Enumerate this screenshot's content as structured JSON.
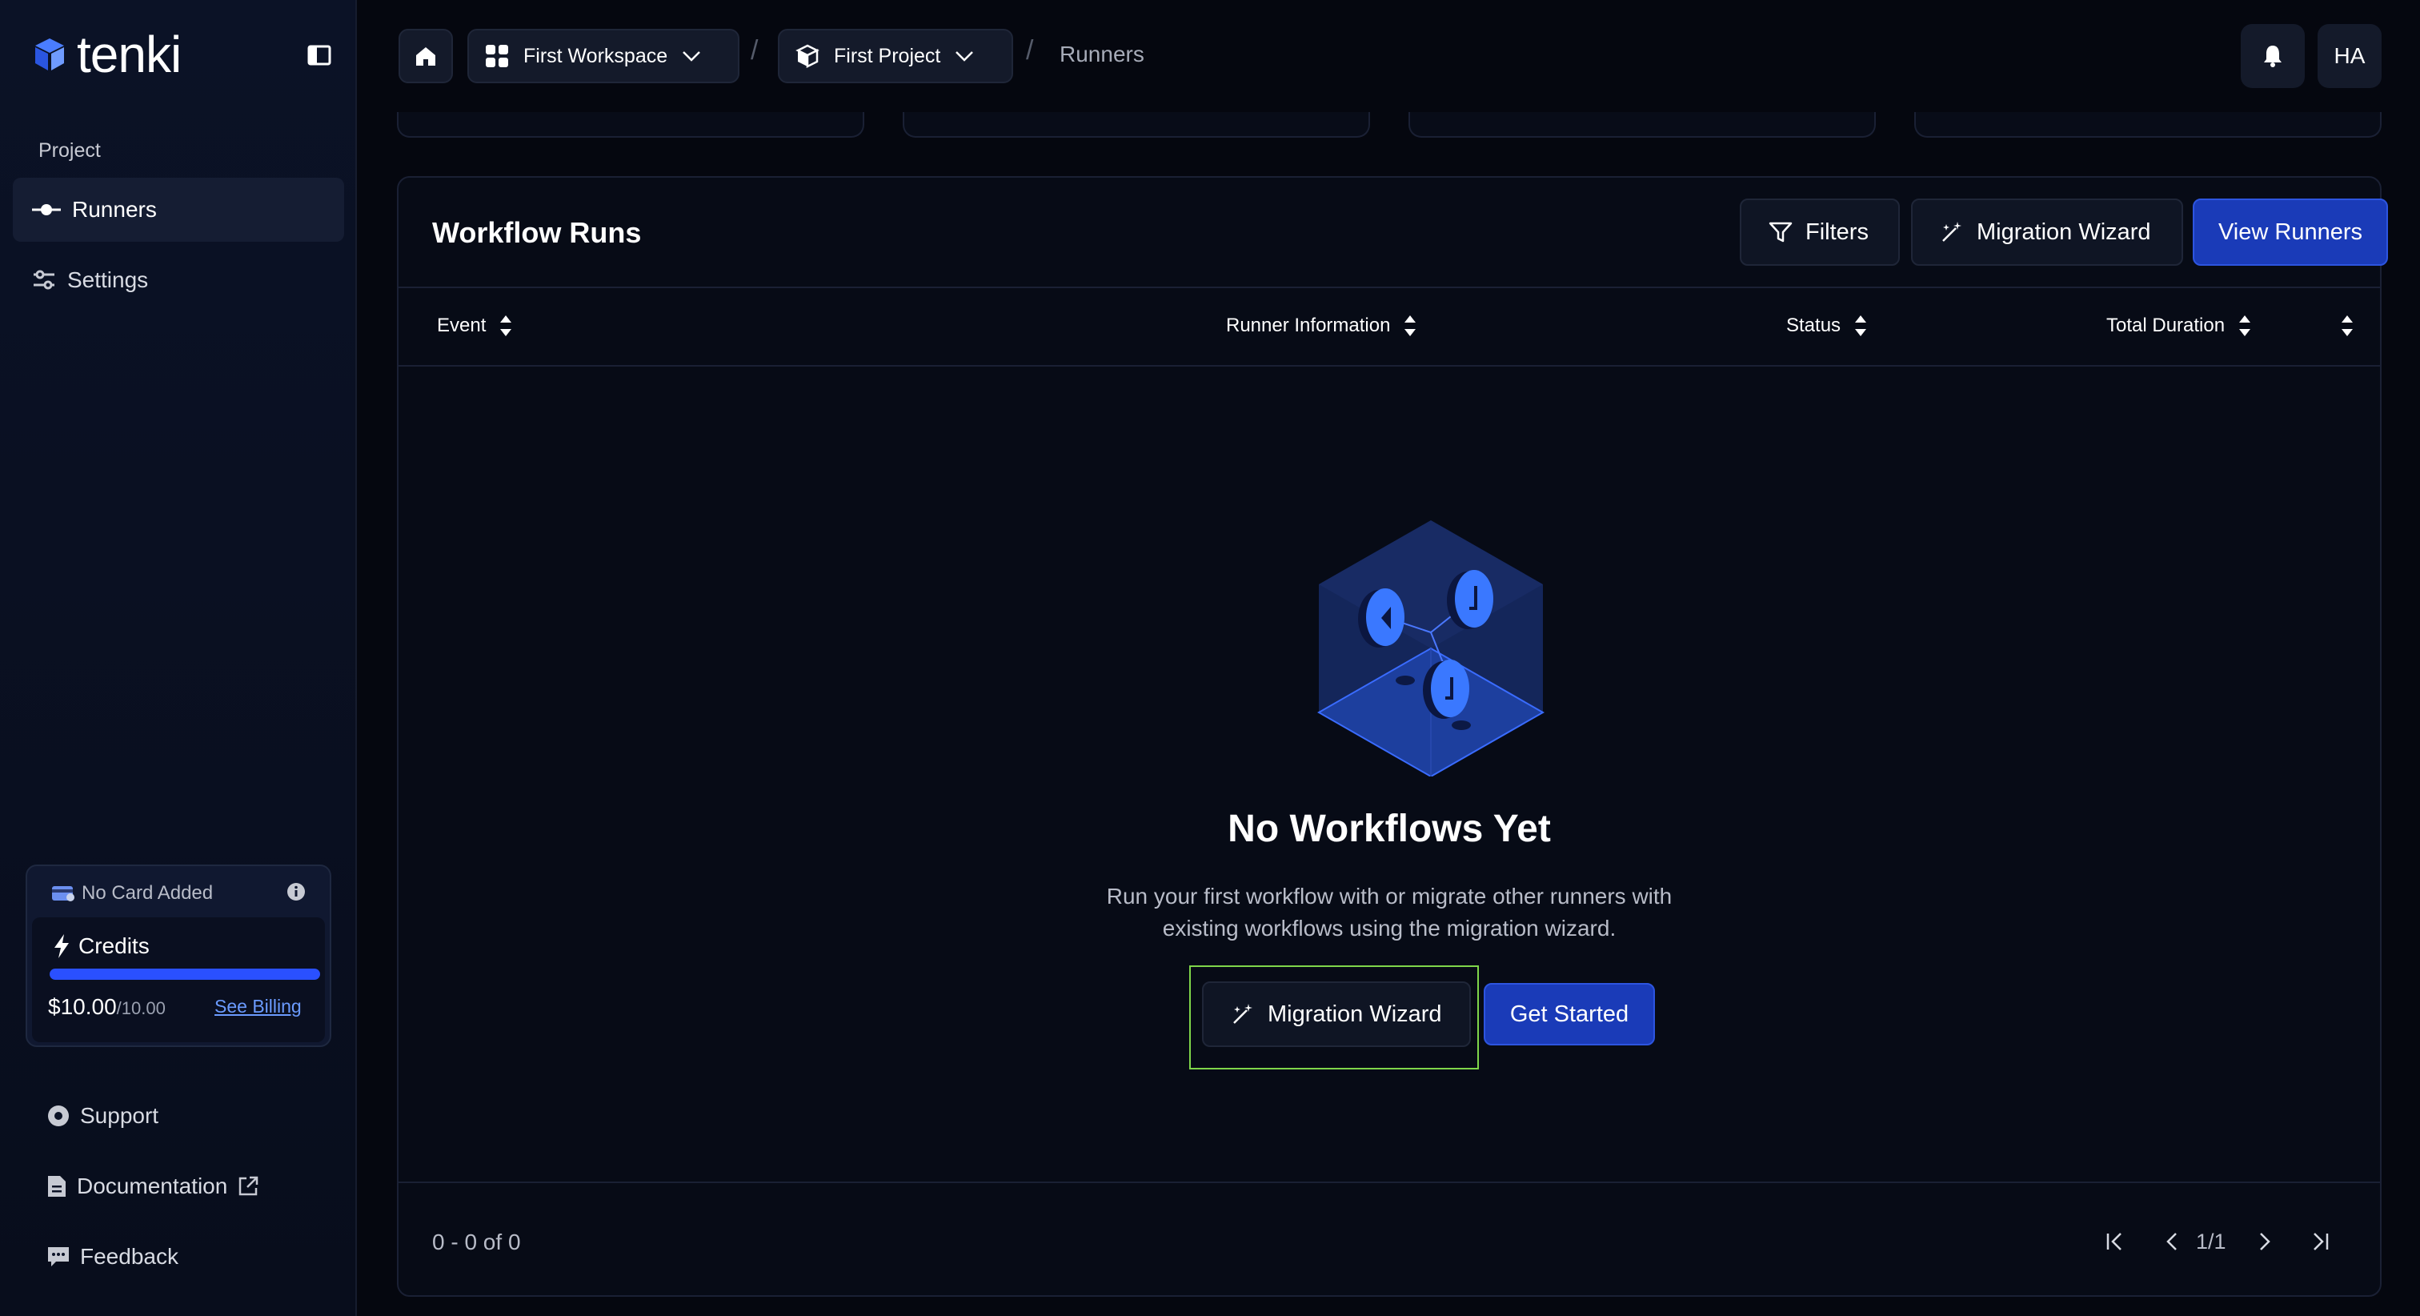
{
  "app": {
    "name": "tenki"
  },
  "colors": {
    "accent": "#1a3bb8",
    "background": "#05070f",
    "highlight": "#7fd64a"
  },
  "sidebar": {
    "section_label": "Project",
    "items": [
      {
        "label": "Runners",
        "icon": "runner-icon",
        "active": true
      },
      {
        "label": "Settings",
        "icon": "sliders-icon",
        "active": false
      }
    ],
    "billing": {
      "card_status": "No Card Added",
      "credits_label": "Credits",
      "credits_fraction": 1.0,
      "amount": "$10.00",
      "amount_max": "/10.00",
      "see_billing": "See Billing"
    },
    "footer": {
      "support": "Support",
      "documentation": "Documentation",
      "feedback": "Feedback"
    }
  },
  "header": {
    "workspace": "First Workspace",
    "project": "First Project",
    "current": "Runners",
    "separator": "/",
    "avatar_initials": "HA"
  },
  "panel": {
    "title": "Workflow Runs",
    "filters_label": "Filters",
    "migration_label": "Migration Wizard",
    "view_runners_label": "View Runners",
    "columns": [
      "Event",
      "Runner Information",
      "Status",
      "Total Duration"
    ],
    "empty": {
      "title": "No Workflows Yet",
      "description": "Run your first workflow with or migrate other runners with existing workflows using the migration wizard.",
      "wizard_label": "Migration Wizard",
      "get_started_label": "Get Started"
    },
    "pagination": {
      "range": "0 - 0 of 0",
      "page": "1/1"
    }
  }
}
